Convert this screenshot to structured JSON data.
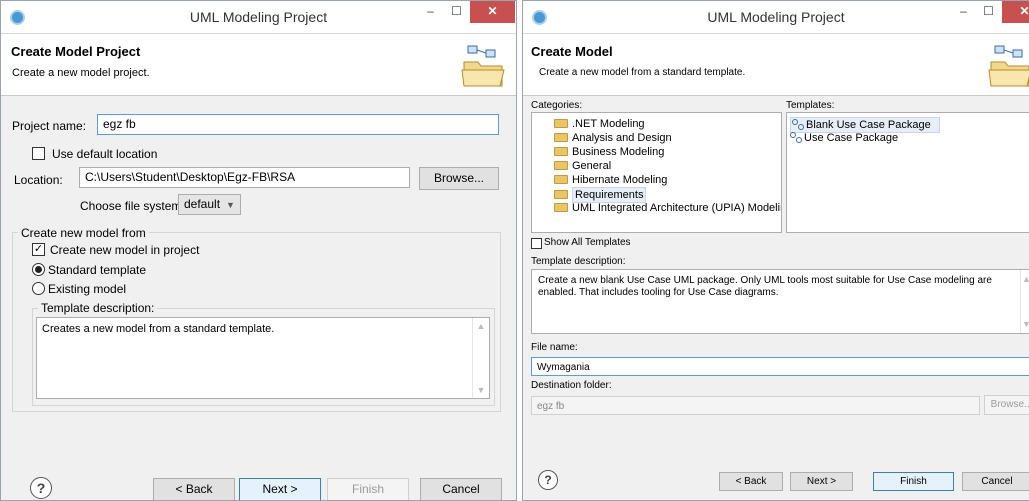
{
  "left_window": {
    "title": "UML Modeling Project",
    "header_title": "Create Model Project",
    "header_desc": "Create a new model project.",
    "project_name_label": "Project name:",
    "project_name_value": "egz fb",
    "use_default_location_label": "Use default location",
    "location_label": "Location:",
    "location_value": "C:\\Users\\Student\\Desktop\\Egz-FB\\RSA",
    "browse_label": "Browse...",
    "file_system_label": "Choose file system:",
    "file_system_value": "default",
    "group_label": "Create new model from",
    "create_model_label": "Create new model in project",
    "standard_template_label": "Standard template",
    "existing_model_label": "Existing model",
    "template_desc_label": "Template description:",
    "template_desc_text": "Creates a new model from a standard template.",
    "back_label": "< Back",
    "next_label": "Next >",
    "finish_label": "Finish",
    "cancel_label": "Cancel",
    "help_label": "?"
  },
  "right_window": {
    "title": "UML Modeling Project",
    "header_title": "Create Model",
    "header_desc": "Create a new model from a standard template.",
    "categories_label": "Categories:",
    "categories": [
      ".NET Modeling",
      "Analysis and Design",
      "Business Modeling",
      "General",
      "Hibernate Modeling",
      "Requirements",
      "UML Integrated Architecture (UPIA) Modeling"
    ],
    "templates_label": "Templates:",
    "templates": [
      "Blank Use Case Package",
      "Use Case Package"
    ],
    "show_all_label": "Show All Templates",
    "template_desc_label": "Template description:",
    "template_desc_text": "Create a new blank Use Case UML package. Only UML tools most suitable for Use Case modeling are enabled. That includes tooling for Use Case diagrams.",
    "file_name_label": "File name:",
    "file_name_value": "Wymagania",
    "dest_folder_label": "Destination folder:",
    "dest_folder_value": "egz fb",
    "browse_label": "Browse...",
    "back_label": "< Back",
    "next_label": "Next >",
    "finish_label": "Finish",
    "cancel_label": "Cancel",
    "help_label": "?"
  }
}
